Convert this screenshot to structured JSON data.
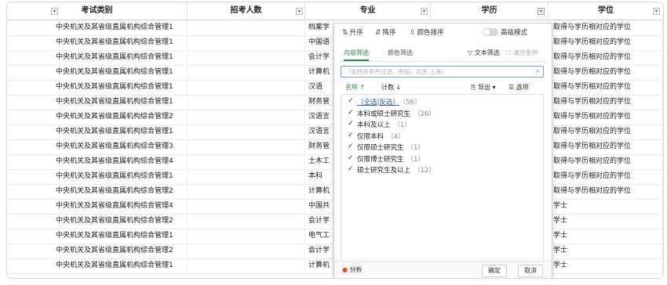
{
  "columns": [
    {
      "label": "考试类别"
    },
    {
      "label": "招考人数"
    },
    {
      "label": "专业"
    },
    {
      "label": "学历"
    },
    {
      "label": "学位"
    }
  ],
  "rows": [
    {
      "category": "中央机关及其省级直属机构综合管理1",
      "major": "档案学",
      "degree": "取得与学历相对应的学位"
    },
    {
      "category": "中央机关及其省级直属机构综合管理1",
      "major": "中国语",
      "degree": "取得与学历相对应的学位"
    },
    {
      "category": "中央机关及其省级直属机构综合管理1",
      "major": "会计学",
      "degree": "取得与学历相对应的学位"
    },
    {
      "category": "中央机关及其省级直属机构综合管理1",
      "major": "计算机",
      "degree": "取得与学历相对应的学位"
    },
    {
      "category": "中央机关及其省级直属机构综合管理1",
      "major": "汉语",
      "degree": "取得与学历相对应的学位"
    },
    {
      "category": "中央机关及其省级直属机构综合管理1",
      "major": "财务管",
      "degree": "取得与学历相对应的学位"
    },
    {
      "category": "中央机关及其省级直属机构综合管理2",
      "major": "汉语言",
      "degree": "取得与学历相对应的学位"
    },
    {
      "category": "中央机关及其省级直属机构综合管理1",
      "major": "汉语言",
      "degree": "取得与学历相对应的学位"
    },
    {
      "category": "中央机关及其省级直属机构综合管理3",
      "major": "财务管",
      "degree": "取得与学历相对应的学位"
    },
    {
      "category": "中央机关及其省级直属机构综合管理4",
      "major": "土木工",
      "degree": "取得与学历相对应的学位"
    },
    {
      "category": "中央机关及其省级直属机构综合管理1",
      "major": "本科",
      "degree": "取得与学历相对应的学位"
    },
    {
      "category": "中央机关及其省级直属机构综合管理2",
      "major": "计算机",
      "degree": "取得与学历相对应的学位"
    },
    {
      "category": "中央机关及其省级直属机构综合管理4",
      "major": "中国共",
      "degree": "学士"
    },
    {
      "category": "中央机关及其省级直属机构综合管理2",
      "major": "会计学",
      "degree": "学士"
    },
    {
      "category": "中央机关及其省级直属机构综合管理1",
      "major": "电气工",
      "degree": "学士"
    },
    {
      "category": "中央机关及其省级直属机构综合管理2",
      "major": "会计学",
      "degree": "学士"
    },
    {
      "category": "中央机关及其省级直属机构综合管理1",
      "major": "计算机",
      "degree": "学士"
    }
  ],
  "panel": {
    "sort_asc": "升序",
    "sort_desc": "降序",
    "sort_color": "颜色排序",
    "advanced_mode": "高级模式",
    "tab_content": "内容筛选",
    "tab_color": "颜色筛选",
    "text_filter": "文本筛选",
    "clear_condition": "清空条件",
    "search_placeholder": "（支持多条件过滤，例如：北京 上海）",
    "col_name": "名称",
    "col_count": "计数",
    "export": "导出",
    "options": "选项",
    "items": [
      {
        "label": "（全选|反选）",
        "count": "（56）"
      },
      {
        "label": "本科或硕士研究生",
        "count": "（26）"
      },
      {
        "label": "本科及以上",
        "count": "（1）"
      },
      {
        "label": "仅限本科",
        "count": "（4）"
      },
      {
        "label": "仅限硕士研究生",
        "count": "（1）"
      },
      {
        "label": "仅限博士研究生",
        "count": "（1）"
      },
      {
        "label": "硕士研究生及以上",
        "count": "（12）"
      }
    ],
    "analyze": "分析",
    "ok": "确定",
    "cancel": "取消"
  }
}
